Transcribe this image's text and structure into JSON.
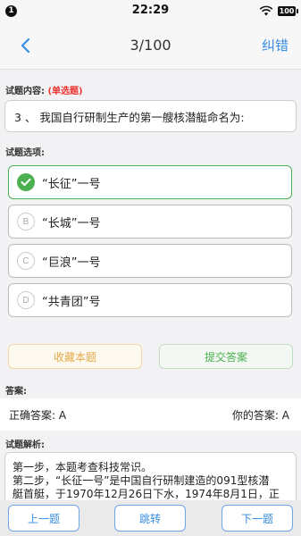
{
  "status": {
    "badge": "1",
    "time": "22:29",
    "battery": "100",
    "wifi_icon": "wifi-icon"
  },
  "header": {
    "back_icon": "chevron-left-icon",
    "title": "3/100",
    "correct_label": "纠错"
  },
  "question": {
    "label": "试题内容:",
    "type_tag": "(单选题)",
    "text": "3 、 我国自行研制生产的第一艘核潜艇命名为:"
  },
  "options": {
    "label": "试题选项:",
    "items": [
      {
        "letter": "A",
        "text": "“长征”一号",
        "selected": true
      },
      {
        "letter": "B",
        "text": "“长城”一号",
        "selected": false
      },
      {
        "letter": "C",
        "text": "“巨浪”一号",
        "selected": false
      },
      {
        "letter": "D",
        "text": "“共青团”号",
        "selected": false
      }
    ]
  },
  "actions": {
    "collect_label": "收藏本题",
    "submit_label": "提交答案"
  },
  "answer": {
    "label": "答案:",
    "correct_text": "正确答案: A",
    "yours_text": "你的答案: A"
  },
  "analysis": {
    "label": "试题解析:",
    "line1": "第一步，本题考查科技常识。",
    "line2": "第二步，“长征一号”是中国自行研制建造的091型核潜",
    "line3": "艇首艇，于1970年12月26日下水，1974年8月1日，正式"
  },
  "footer": {
    "prev_label": "上一题",
    "jump_label": "跳转",
    "next_label": "下一题"
  },
  "colors": {
    "accent_blue": "#3a8ee6",
    "selected_green": "#4caf50",
    "tag_red": "#e33333",
    "collect_orange": "#e3a84a"
  }
}
